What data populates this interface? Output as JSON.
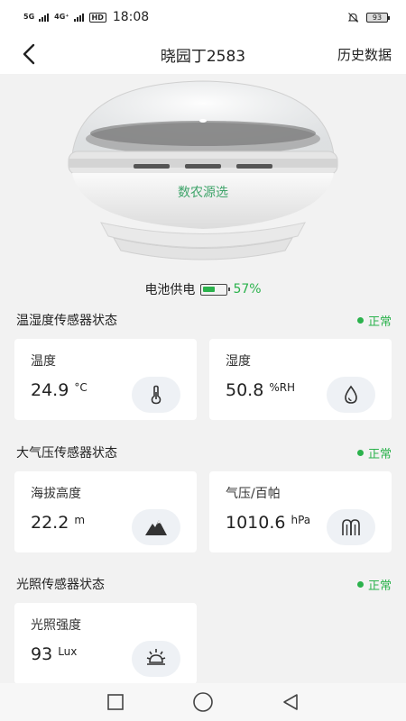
{
  "status_bar": {
    "signal_1": "5G",
    "signal_2": "4G⁺",
    "hd": "HD",
    "time": "18:08",
    "battery": "93"
  },
  "header": {
    "title": "晓园丁2583",
    "history_label": "历史数据"
  },
  "device": {
    "brand_text": "数农源选",
    "power_label": "电池供电",
    "battery_percent": "57%",
    "battery_level": 0.57
  },
  "sections": [
    {
      "title": "温湿度传感器状态",
      "status": "正常",
      "cards": [
        {
          "label": "温度",
          "value": "24.9",
          "unit": "°C",
          "icon": "thermometer-icon"
        },
        {
          "label": "湿度",
          "value": "50.8",
          "unit": "%RH",
          "icon": "water-drop-icon"
        }
      ]
    },
    {
      "title": "大气压传感器状态",
      "status": "正常",
      "cards": [
        {
          "label": "海拔高度",
          "value": "22.2",
          "unit": "m",
          "icon": "mountain-icon"
        },
        {
          "label": "气压/百帕",
          "value": "1010.6",
          "unit": "hPa",
          "icon": "pressure-icon"
        }
      ]
    },
    {
      "title": "光照传感器状态",
      "status": "正常",
      "cards": [
        {
          "label": "光照强度",
          "value": "93",
          "unit": "Lux",
          "icon": "sun-icon"
        }
      ]
    }
  ],
  "colors": {
    "accent_green": "#2bb24c",
    "background": "#f2f2f2",
    "card": "#ffffff"
  }
}
